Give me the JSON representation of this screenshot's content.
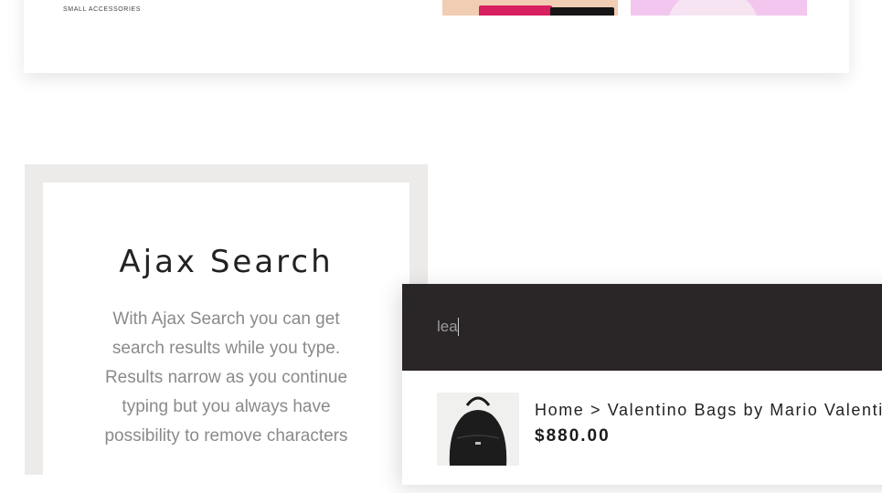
{
  "category_card": {
    "label": "SMALL ACCESSORIES"
  },
  "feature": {
    "title": "Ajax Search",
    "description": "With Ajax Search you can get search results while you type. Results narrow as you continue typing but you always have possibility to remove characters"
  },
  "search": {
    "query": "lea",
    "results": [
      {
        "breadcrumb": "Home > Valentino Bags by Mario Valentino",
        "price": "$880.00"
      }
    ]
  },
  "colors": {
    "search_bar_bg": "#2a2627",
    "frame_bg": "#edebe9",
    "thumb_peach": "#f1cdb3",
    "thumb_pink": "#f2c6ee"
  }
}
